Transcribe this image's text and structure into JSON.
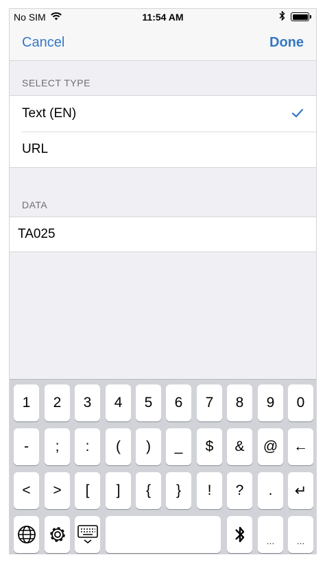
{
  "status_bar": {
    "carrier": "No SIM",
    "time": "11:54 AM"
  },
  "nav": {
    "cancel_label": "Cancel",
    "done_label": "Done"
  },
  "select_type": {
    "header": "SELECT TYPE",
    "options": [
      {
        "label": "Text (EN)",
        "selected": true
      },
      {
        "label": "URL",
        "selected": false
      }
    ]
  },
  "data_section": {
    "header": "DATA",
    "value": "TA025"
  },
  "keyboard": {
    "row1": [
      "1",
      "2",
      "3",
      "4",
      "5",
      "6",
      "7",
      "8",
      "9",
      "0"
    ],
    "row2": [
      "-",
      ";",
      ":",
      "(",
      ")",
      "_",
      "$",
      "&",
      "@",
      "←"
    ],
    "row3": [
      "<",
      ">",
      "[",
      "]",
      "{",
      "}",
      "!",
      "?",
      ".",
      "↵"
    ],
    "row4": [
      "globe-icon",
      "gear-icon",
      "keyboard-dismiss-icon",
      "space",
      "bluetooth-icon",
      "…",
      "…"
    ]
  },
  "colors": {
    "accent": "#3478c6",
    "background": "#efeff4",
    "keyboard": "#d1d3d9"
  }
}
